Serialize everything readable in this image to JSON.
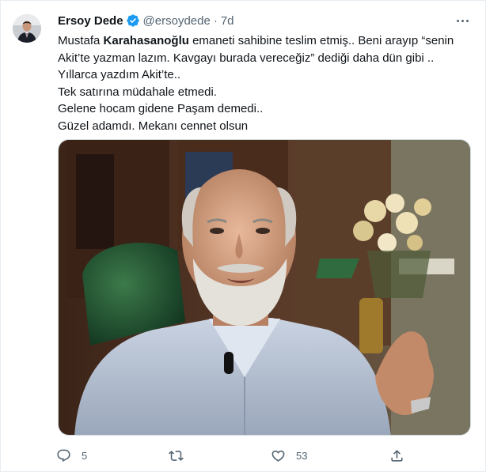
{
  "tweet": {
    "display_name": "Ersoy Dede",
    "handle": "@ersoydede",
    "separator": "·",
    "time": "7d",
    "lines": [
      {
        "pre": "Mustafa ",
        "bold": "Karahasanoğlu",
        "post": " emaneti sahibine teslim etmiş.. Beni arayıp “senin"
      },
      {
        "pre": "Akit’te yazman lazım. Kavgayı burada vereceğiz” dediği daha dün gibi ..",
        "bold": "",
        "post": ""
      },
      {
        "pre": "Yıllarca yazdım Akit’te..",
        "bold": "",
        "post": ""
      },
      {
        "pre": "Tek satırına müdahale etmedi.",
        "bold": "",
        "post": ""
      },
      {
        "pre": "Gelene hocam gidene Paşam demedi..",
        "bold": "",
        "post": ""
      },
      {
        "pre": "Güzel adamdı. Mekanı cennet olsun",
        "bold": "",
        "post": ""
      }
    ]
  },
  "actions": {
    "reply_count": "5",
    "retweet_count": "",
    "like_count": "53",
    "share_count": ""
  },
  "icons": {
    "verified": "verified-badge-icon",
    "more": "more-dots-icon",
    "reply": "reply-icon",
    "retweet": "retweet-icon",
    "like": "heart-icon",
    "share": "share-icon"
  },
  "colors": {
    "verified_blue": "#1d9bf0",
    "secondary_text": "#536471",
    "primary_text": "#0f1419",
    "border": "#e6ecf0"
  }
}
